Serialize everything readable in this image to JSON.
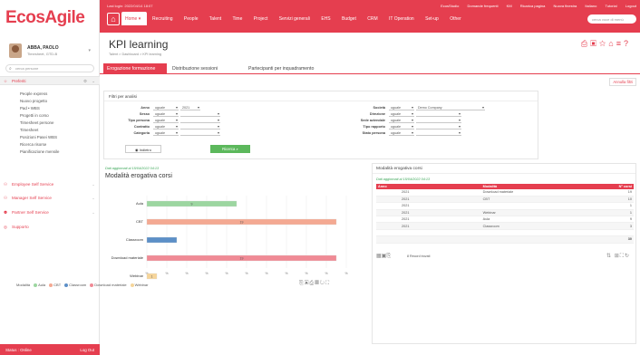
{
  "brand": {
    "logo": "EcosAgile"
  },
  "user": {
    "name": "ABBA, PAOLO",
    "role": "Timesheet, GTD-B"
  },
  "sidebar": {
    "search_placeholder": "cerca persone",
    "preferiti": "Preferiti",
    "items": [
      "People express",
      "Nuovo progetto",
      "Pad • WBS",
      "Progetti in corso",
      "Timesheet persone",
      "Timesheet",
      "Posizioni Pasei WBS",
      "Ricerca risorse",
      "Pianificazione mensile"
    ],
    "sections": [
      "Employee Self Service",
      "Manager Self Service",
      "Partner Self Service",
      "Supporto"
    ],
    "status": "Status : Online",
    "logout": "Log Out"
  },
  "topbar": {
    "last_login": "Last login: 2022/04/14 18:07",
    "links": [
      "EcosStudio",
      "Domande frequenti",
      "KM",
      "Ricarica pagina",
      "Nuova finestra",
      "Italiano",
      "Tutorial",
      "Logout"
    ],
    "home_label": "Home",
    "menu": [
      "Recruiting",
      "People",
      "Talent",
      "Time",
      "Project",
      "Servizi generali",
      "EHS",
      "Budget",
      "CRM",
      "IT Operation",
      "Set-up",
      "Other"
    ],
    "search_placeholder": "cerca voce di menù"
  },
  "page": {
    "title": "KPI learning",
    "breadcrumb": "Talent > Dashboard > KPI learning",
    "tabs": [
      "Erogazione formazione",
      "Distribuzione sessioni",
      "Partecipanti per inquadramento"
    ],
    "action": "Annulla filtri"
  },
  "filters": {
    "header": "Filtri per analisi",
    "left": [
      {
        "label": "Anno",
        "op": "uguale",
        "value": "2021"
      },
      {
        "label": "Sesso",
        "op": "uguale",
        "value": ""
      },
      {
        "label": "Tipo persona",
        "op": "uguale",
        "value": ""
      },
      {
        "label": "Contratto",
        "op": "uguale",
        "value": ""
      },
      {
        "label": "Categoria",
        "op": "uguale",
        "value": ""
      }
    ],
    "right": [
      {
        "label": "Società",
        "op": "uguale",
        "value": "Demo Company"
      },
      {
        "label": "Direzione",
        "op": "uguale",
        "value": ""
      },
      {
        "label": "Sede aziendale",
        "op": "uguale",
        "value": ""
      },
      {
        "label": "Tipo rapporto",
        "op": "uguale",
        "value": ""
      },
      {
        "label": "Stato persona",
        "op": "uguale",
        "value": ""
      }
    ],
    "back_button": "Indietro",
    "search_button": "Ricerca"
  },
  "chart": {
    "updated": "Dati aggiornati al 15/04/2022 04:13",
    "title": "Modalità erogativa corsi",
    "legend_title": "Modalità"
  },
  "chart_data": {
    "type": "bar",
    "orientation": "horizontal",
    "categories": [
      "Aula",
      "CBT",
      "Classroom",
      "Download materiale",
      "Webinar"
    ],
    "values": [
      9,
      19,
      3,
      19,
      1
    ],
    "value_labels": [
      "9",
      "19",
      "",
      "19",
      "1"
    ],
    "colors": [
      "#9cd6a0",
      "#f4a992",
      "#5c8fc7",
      "#f08a95",
      "#f6d59a"
    ],
    "series_names": [
      "Aula",
      "CBT",
      "Classroom",
      "Download materiale",
      "Webinar"
    ],
    "xlim": [
      0,
      20
    ],
    "xticks": [
      "0",
      "2",
      "4",
      "6",
      "8",
      "10",
      "12",
      "14",
      "16",
      "18",
      "20"
    ],
    "tick_labels_visible": [
      "%",
      "%",
      "%",
      "%",
      "%",
      "%",
      "%",
      "%",
      "%",
      "%",
      "%"
    ],
    "legend": "bottom",
    "grid": true
  },
  "table": {
    "header": "Modalità erogativa corsi",
    "updated": "Dati aggiornati al 15/04/2022 04:13",
    "columns": [
      "Anno",
      "Modalità",
      "N° corsi"
    ],
    "rows": [
      [
        "2021",
        "Download materiale",
        "19"
      ],
      [
        "2021",
        "CBT",
        "10"
      ],
      [
        "2021",
        "",
        "1"
      ],
      [
        "2021",
        "Webinar",
        "1"
      ],
      [
        "2021",
        "Aula",
        "9"
      ],
      [
        "2021",
        "Classroom",
        "3"
      ],
      [
        "",
        "",
        ""
      ],
      [
        "",
        "",
        "30"
      ]
    ],
    "records": "8 Record trovati"
  },
  "colors": {
    "accent": "#e53e4f",
    "green": "#5cb85c"
  }
}
